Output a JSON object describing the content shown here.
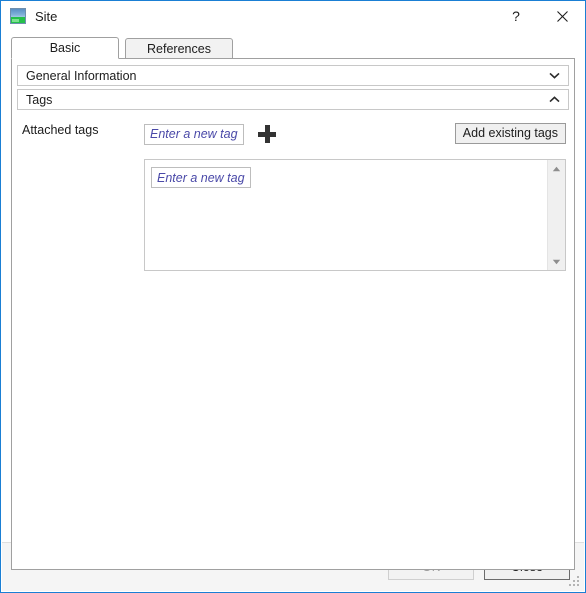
{
  "window": {
    "title": "Site",
    "icon": "site-image-icon",
    "border_color": "#1a7fd4",
    "help_label": "?",
    "close_label": "✕"
  },
  "tabs": [
    {
      "label": "Basic",
      "active": true
    },
    {
      "label": "References",
      "active": false
    }
  ],
  "sections": [
    {
      "label": "General Information",
      "expanded": false,
      "chevron": "chevron-down-icon"
    },
    {
      "label": "Tags",
      "expanded": true,
      "chevron": "chevron-up-icon"
    }
  ],
  "tags": {
    "attached_label": "Attached tags",
    "new_tag_placeholder": "Enter a new tag",
    "new_tag_value": "",
    "add_icon": "plus-icon",
    "add_existing_label": "Add existing tags",
    "list_placeholder": "Enter a new tag",
    "list_value": "",
    "list_items": [],
    "scroll_up": "scroll-up-arrow-icon",
    "scroll_down": "scroll-down-arrow-icon",
    "placeholder_color": "#4a49a8"
  },
  "footer": {
    "ok_label": "OK",
    "ok_enabled": false,
    "close_label": "Close",
    "close_enabled": true
  }
}
